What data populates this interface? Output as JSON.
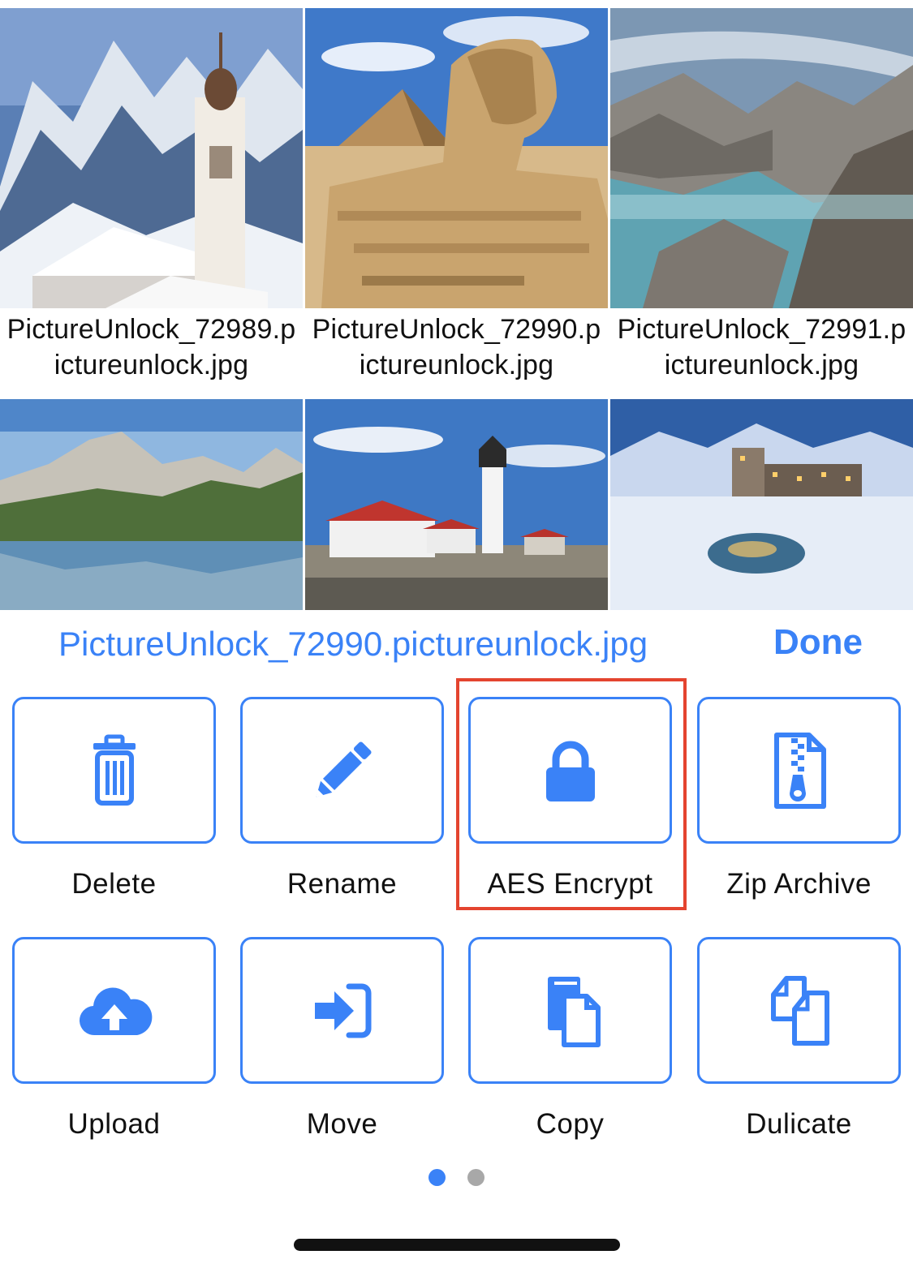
{
  "thumbnails": [
    {
      "caption": "PictureUnlock_72989.pictureunlock.jpg",
      "scene": "alpine-church-icon"
    },
    {
      "caption": "PictureUnlock_72990.pictureunlock.jpg",
      "scene": "sphinx-pyramid-icon"
    },
    {
      "caption": "PictureUnlock_72991.pictureunlock.jpg",
      "scene": "rocky-coast-icon"
    },
    {
      "scene": "mountain-lake-icon"
    },
    {
      "scene": "lighthouse-icon"
    },
    {
      "scene": "snow-village-icon"
    }
  ],
  "sheet": {
    "title": "PictureUnlock_72990.pictureunlock.jpg",
    "done_label": "Done",
    "selected_action": "AES Encrypt",
    "actions": [
      {
        "label": "Delete",
        "icon": "trash-icon"
      },
      {
        "label": "Rename",
        "icon": "pencil-icon"
      },
      {
        "label": "AES Encrypt",
        "icon": "lock-icon"
      },
      {
        "label": "Zip Archive",
        "icon": "zip-file-icon"
      },
      {
        "label": "Upload",
        "icon": "cloud-upload-icon"
      },
      {
        "label": "Move",
        "icon": "move-in-icon"
      },
      {
        "label": "Copy",
        "icon": "copy-icon"
      },
      {
        "label": "Dulicate",
        "icon": "duplicate-icon"
      }
    ]
  },
  "pager": {
    "page_count": 2,
    "current_page": 1
  },
  "colors": {
    "accent": "#3a82f7",
    "highlight": "#e4442f",
    "dot_inactive": "#a8a8a8",
    "text": "#111111"
  }
}
